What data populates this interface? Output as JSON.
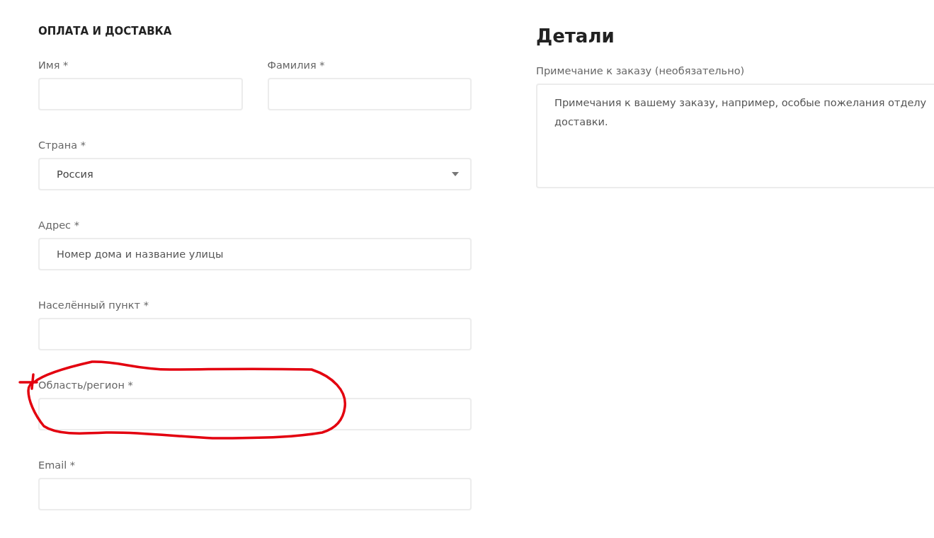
{
  "billing": {
    "title": "ОПЛАТА И ДОСТАВКА",
    "rows": [
      [
        {
          "kind": "input",
          "label": "Имя *"
        },
        {
          "kind": "input",
          "label": "Фамилия *"
        }
      ],
      [
        {
          "kind": "select",
          "label": "Страна *",
          "value": "Россия"
        }
      ],
      [
        {
          "kind": "input",
          "label": "Адрес *",
          "placeholder": "Номер дома и название улицы"
        }
      ],
      [
        {
          "kind": "input",
          "label": "Населённый пункт *"
        }
      ],
      [
        {
          "kind": "input",
          "label": "Область/регион *"
        }
      ],
      [
        {
          "kind": "input",
          "label": "Email *"
        }
      ]
    ]
  },
  "details": {
    "title": "Детали",
    "fields": [
      {
        "kind": "textarea",
        "label": "Примечание к заказу (необязательно)",
        "placeholder": "Примечания к вашему заказу, например, особые пожелания отделу доставки."
      }
    ]
  }
}
